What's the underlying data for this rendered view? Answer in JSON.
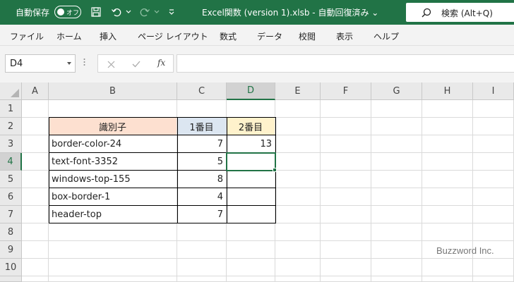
{
  "titlebar": {
    "autosave_label": "自動保存",
    "autosave_state": "オフ",
    "title": "Excel関数 (version 1).xlsb  -  自動回復済み  ⌄",
    "search_placeholder": "検索 (Alt+Q)"
  },
  "ribbon": {
    "tabs": [
      "ファイル",
      "ホーム",
      "挿入",
      "ページ レイアウト",
      "数式",
      "データ",
      "校閲",
      "表示",
      "ヘルプ"
    ]
  },
  "formula_bar": {
    "name_box": "D4",
    "fx_label": "fx",
    "formula": ""
  },
  "sheet": {
    "columns": [
      "A",
      "B",
      "C",
      "D",
      "E",
      "F",
      "G",
      "H",
      "I"
    ],
    "rows": [
      "1",
      "2",
      "3",
      "4",
      "5",
      "6",
      "7",
      "8",
      "9",
      "10"
    ],
    "selected_cell": "D4",
    "header": [
      "識別子",
      "1番目",
      "2番目"
    ],
    "data": [
      {
        "id": "border-color-24",
        "first": "7",
        "second": "13"
      },
      {
        "id": "text-font-3352",
        "first": "5",
        "second": ""
      },
      {
        "id": "windows-top-155",
        "first": "8",
        "second": ""
      },
      {
        "id": "box-border-1",
        "first": "4",
        "second": ""
      },
      {
        "id": "header-top",
        "first": "7",
        "second": ""
      }
    ],
    "colors": {
      "header_b": "#fde0d0",
      "header_c": "#dce6f1",
      "header_d": "#fff2cc",
      "accent": "#217346"
    }
  },
  "watermark": "Buzzword Inc."
}
